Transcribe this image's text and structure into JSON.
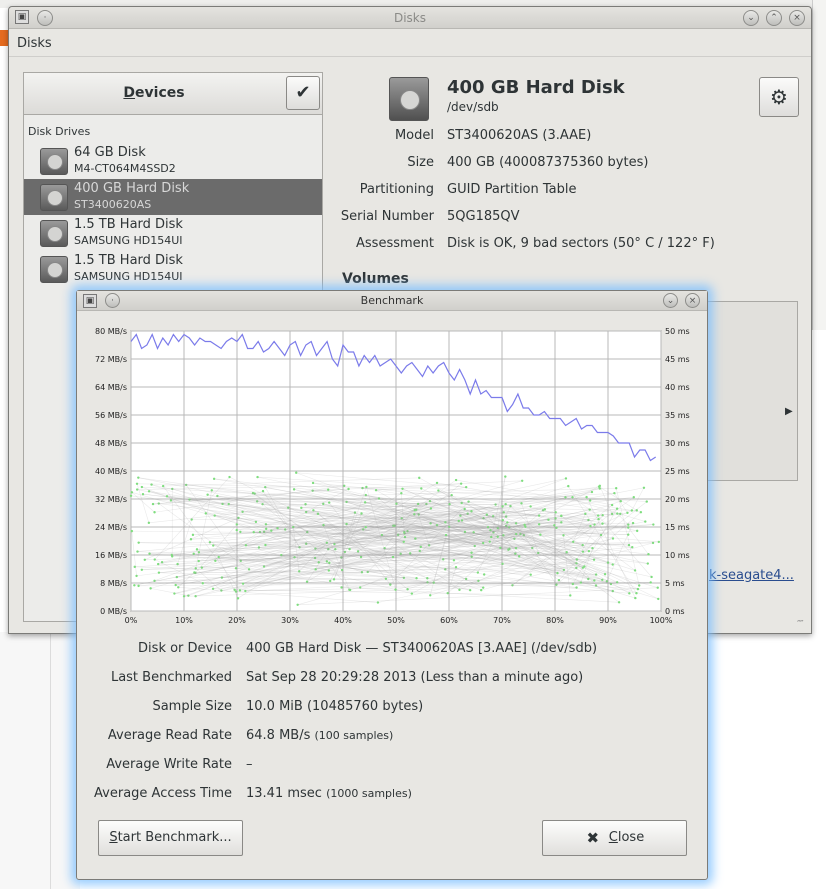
{
  "disks_window": {
    "title": "Disks",
    "menu_label": "Disks",
    "devices_title": "Devices",
    "devices_title_mnemonic": "D",
    "devices_title_rest": "evices",
    "group_label": "Disk Drives",
    "devices": [
      {
        "name": "64 GB Disk",
        "model": "M4-CT064M4SSD2",
        "selected": false
      },
      {
        "name": "400 GB Hard Disk",
        "model": "ST3400620AS",
        "selected": true
      },
      {
        "name": "1.5 TB Hard Disk",
        "model": "SAMSUNG HD154UI",
        "selected": false
      },
      {
        "name": "1.5 TB Hard Disk",
        "model": "SAMSUNG HD154UI",
        "selected": false
      }
    ],
    "detail": {
      "title": "400 GB Hard Disk",
      "path": "/dev/sdb",
      "rows": [
        {
          "label": "Model",
          "value": "ST3400620AS (3.AAE)"
        },
        {
          "label": "Size",
          "value": "400 GB (400087375360 bytes)"
        },
        {
          "label": "Partitioning",
          "value": "GUID Partition Table"
        },
        {
          "label": "Serial Number",
          "value": "5QG185QV"
        },
        {
          "label": "Assessment",
          "value": "Disk is OK, 9 bad sectors (50° C / 122° F)"
        }
      ],
      "volumes_label": "Volumes"
    },
    "background_link": "k-seagate4..."
  },
  "benchmark": {
    "title": "Benchmark",
    "rows": [
      {
        "label": "Disk or Device",
        "value": "400 GB Hard Disk — ST3400620AS [3.AAE] (/dev/sdb)",
        "note": ""
      },
      {
        "label": "Last Benchmarked",
        "value": "Sat Sep 28 20:29:28 2013 (Less than a minute ago)",
        "note": ""
      },
      {
        "label": "Sample Size",
        "value": "10.0 MiB (10485760 bytes)",
        "note": ""
      },
      {
        "label": "Average Read Rate",
        "value": "64.8 MB/s",
        "note": "(100 samples)"
      },
      {
        "label": "Average Write Rate",
        "value": "–",
        "note": ""
      },
      {
        "label": "Average Access Time",
        "value": "13.41 msec",
        "note": "(1000 samples)"
      }
    ],
    "start_button": "Start Benchmark...",
    "start_mnemonic": "S",
    "start_rest": "tart Benchmark...",
    "close_button": "Close",
    "close_mnemonic": "C",
    "close_rest": "lose"
  },
  "chart_data": {
    "type": "line",
    "title": "",
    "y_left_ticks": [
      "0 MB/s",
      "8 MB/s",
      "16 MB/s",
      "24 MB/s",
      "32 MB/s",
      "40 MB/s",
      "48 MB/s",
      "56 MB/s",
      "64 MB/s",
      "72 MB/s",
      "80 MB/s"
    ],
    "y_right_ticks": [
      "0 ms",
      "5 ms",
      "10 ms",
      "15 ms",
      "20 ms",
      "25 ms",
      "30 ms",
      "35 ms",
      "40 ms",
      "45 ms",
      "50 ms"
    ],
    "x_ticks": [
      "0%",
      "10%",
      "20%",
      "30%",
      "40%",
      "50%",
      "60%",
      "70%",
      "80%",
      "90%",
      "100%"
    ],
    "ylim_left": [
      0,
      80
    ],
    "ylim_right": [
      0,
      50
    ],
    "xlim": [
      0,
      100
    ],
    "grid": true,
    "read_color": "#7b7bea",
    "access_color": "#7ee07e",
    "series": [
      {
        "values_x": [
          0,
          1,
          2,
          3,
          4,
          5,
          6,
          7,
          8,
          9,
          10,
          11,
          12,
          13,
          14,
          15,
          16,
          17,
          18,
          19,
          20,
          21,
          22,
          23,
          24,
          25,
          26,
          27,
          28,
          29,
          30,
          31,
          32,
          33,
          34,
          35,
          36,
          37,
          38,
          39,
          40,
          41,
          42,
          43,
          44,
          45,
          46,
          47,
          48,
          49,
          50,
          51,
          52,
          53,
          54,
          55,
          56,
          57,
          58,
          59,
          60,
          61,
          62,
          63,
          64,
          65,
          66,
          67,
          68,
          69,
          70,
          71,
          72,
          73,
          74,
          75,
          76,
          77,
          78,
          79,
          80,
          81,
          82,
          83,
          84,
          85,
          86,
          87,
          88,
          89,
          90,
          91,
          92,
          93,
          94,
          95,
          96,
          97,
          98,
          99
        ],
        "values_y": [
          77,
          79,
          75,
          76,
          79,
          75,
          78,
          76,
          79,
          77,
          79,
          78,
          76,
          78,
          77,
          77,
          76,
          75,
          77,
          78,
          77,
          79,
          75,
          75,
          77,
          74,
          75,
          77,
          75,
          73,
          76,
          77,
          73,
          76,
          77,
          73,
          75,
          77,
          72,
          70,
          76,
          74,
          74,
          70,
          73,
          71,
          73,
          70,
          71,
          72,
          70,
          68,
          70,
          71,
          69,
          67,
          70,
          68,
          70,
          71,
          68,
          66,
          69,
          66,
          62,
          66,
          62,
          63,
          61,
          61,
          61,
          57,
          59,
          62,
          58,
          58,
          56,
          56,
          57,
          55,
          55,
          55,
          53,
          54,
          55,
          52,
          53,
          53,
          51,
          51,
          51,
          50,
          48,
          48,
          48,
          44,
          46,
          46,
          43,
          44
        ]
      }
    ]
  }
}
